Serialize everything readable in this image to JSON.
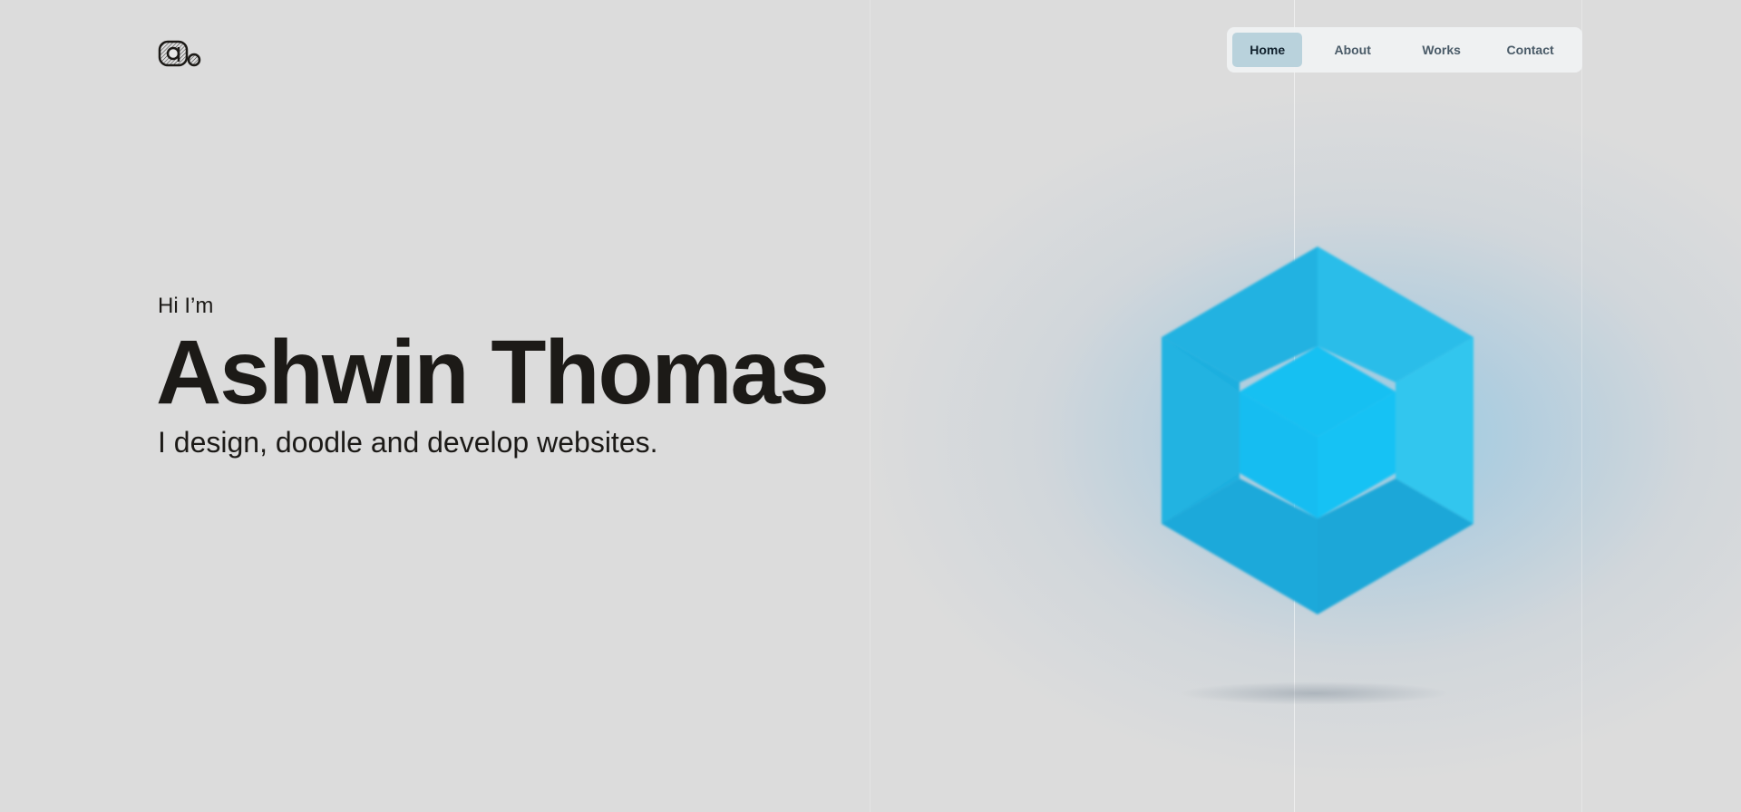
{
  "logo": {
    "text": "a.",
    "icon": "ashwin-logo-icon"
  },
  "nav": {
    "items": [
      {
        "label": "Home",
        "active": true
      },
      {
        "label": "About",
        "active": false
      },
      {
        "label": "Works",
        "active": false
      },
      {
        "label": "Contact",
        "active": false
      }
    ]
  },
  "hero": {
    "greeting": "Hi I’m",
    "name": "Ashwin Thomas",
    "tagline": "I design, doodle and develop websites."
  },
  "colors": {
    "background": "#dcdcdc",
    "text": "#1c1a17",
    "nav_active_bg": "#b9d2dc",
    "cube_light": "#37c6ef",
    "cube_mid": "#1fb4e3",
    "cube_dark": "#119ed0"
  },
  "graphic": {
    "icon": "hexagon-cube-icon"
  }
}
